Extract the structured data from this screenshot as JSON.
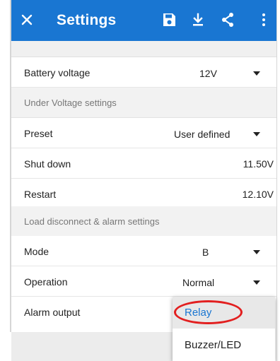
{
  "appbar": {
    "title": "Settings",
    "background": "#1976d2",
    "icons": [
      "close-icon",
      "save-icon",
      "download-icon",
      "share-icon",
      "more-vert-icon"
    ]
  },
  "rows": {
    "battery_voltage": {
      "label": "Battery voltage",
      "value": "12V"
    },
    "under_voltage_header": "Under Voltage settings",
    "preset": {
      "label": "Preset",
      "value": "User defined"
    },
    "shut_down": {
      "label": "Shut down",
      "value": "11.50V"
    },
    "restart": {
      "label": "Restart",
      "value": "12.10V"
    },
    "load_header": "Load disconnect & alarm settings",
    "mode": {
      "label": "Mode",
      "value": "B"
    },
    "operation": {
      "label": "Operation",
      "value": "Normal"
    },
    "alarm_output": {
      "label": "Alarm output"
    }
  },
  "dropdown": {
    "options": [
      "Relay",
      "Buzzer/LED"
    ],
    "selected": "Relay",
    "highlight_color": "#1976d2",
    "annotation_color": "#e21f1f"
  }
}
